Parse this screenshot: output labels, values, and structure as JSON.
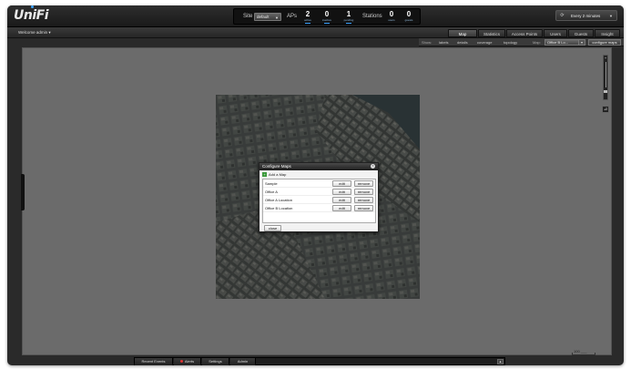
{
  "app": {
    "logo": "UniFi"
  },
  "stats": {
    "site_label": "Site",
    "site_value": "default",
    "aps_label": "APs",
    "stations_label": "Stations",
    "aps": [
      {
        "value": "2",
        "label": "active"
      },
      {
        "value": "0",
        "label": "inactive"
      },
      {
        "value": "1",
        "label": "pending"
      }
    ],
    "stations": [
      {
        "value": "0",
        "label": "users"
      },
      {
        "value": "0",
        "label": "guests"
      }
    ]
  },
  "refresh": {
    "label": "Every 2 minutes"
  },
  "subbar": {
    "welcome": "Welcome admin ▾"
  },
  "tabs": [
    {
      "label": "Map",
      "active": true
    },
    {
      "label": "Statistics",
      "active": false
    },
    {
      "label": "Access Points",
      "active": false
    },
    {
      "label": "Users",
      "active": false
    },
    {
      "label": "Guests",
      "active": false
    },
    {
      "label": "Insight",
      "active": false
    }
  ],
  "options": {
    "show_label": "Show:",
    "items": [
      "labels",
      "details",
      "coverage",
      "topology"
    ],
    "map_label": "Map:",
    "map_value": "Office B Lo...",
    "configure_label": "configure maps"
  },
  "dialog": {
    "title": "Configure Maps",
    "add_label": "Add a Map",
    "edit_label": "edit",
    "remove_label": "remove",
    "close_label": "close",
    "maps": [
      "Sample",
      "Office A",
      "Office A Location",
      "Office B Location"
    ]
  },
  "map": {
    "scale_label": "100 ___"
  },
  "bottom_tabs": [
    "Recent Events",
    "Alerts",
    "Settings",
    "Admin"
  ],
  "colors": {
    "accent": "#3da5ff",
    "alert": "#d33333",
    "add_green": "#3c9a3c"
  }
}
